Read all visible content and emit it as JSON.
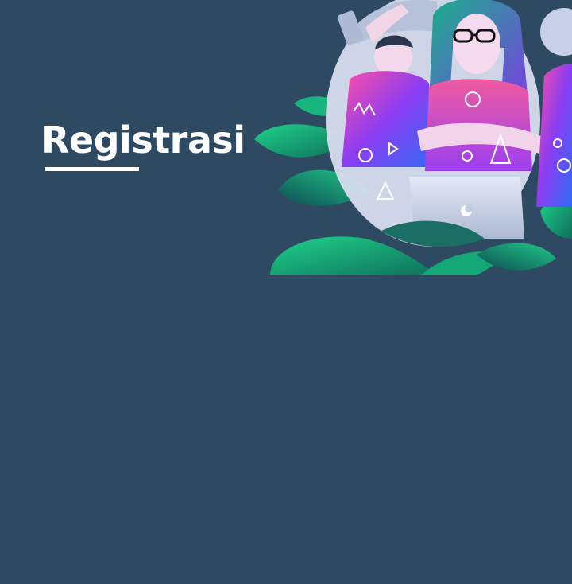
{
  "header": {
    "title": "Registrasi"
  },
  "illustration": {
    "name": "students-with-laptop-illustration"
  },
  "colors": {
    "background": "#2e4a63",
    "title_text": "#ffffff",
    "underline": "#ffffff"
  }
}
